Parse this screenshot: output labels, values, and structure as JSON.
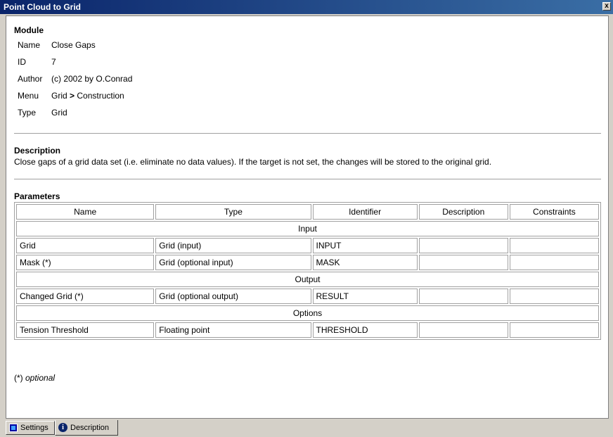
{
  "window": {
    "title": "Point Cloud to Grid",
    "close_glyph": "x"
  },
  "module": {
    "heading": "Module",
    "rows": [
      {
        "key": "Name",
        "value": "Close Gaps"
      },
      {
        "key": "ID",
        "value": "7"
      },
      {
        "key": "Author",
        "value": "(c) 2002 by O.Conrad"
      },
      {
        "key": "Menu",
        "value_parts": [
          "Grid ",
          ">",
          " Construction"
        ]
      },
      {
        "key": "Type",
        "value": "Grid"
      }
    ]
  },
  "description": {
    "heading": "Description",
    "text": "Close gaps of a grid data set (i.e. eliminate no data values). If the target is not set, the changes will be stored to the original grid."
  },
  "parameters": {
    "heading": "Parameters",
    "columns": [
      "Name",
      "Type",
      "Identifier",
      "Description",
      "Constraints"
    ],
    "groups": [
      {
        "label": "Input",
        "rows": [
          [
            "Grid",
            "Grid (input)",
            "INPUT",
            "",
            ""
          ],
          [
            "Mask (*)",
            "Grid (optional input)",
            "MASK",
            "",
            ""
          ]
        ]
      },
      {
        "label": "Output",
        "rows": [
          [
            "Changed Grid (*)",
            "Grid (optional output)",
            "RESULT",
            "",
            ""
          ]
        ]
      },
      {
        "label": "Options",
        "rows": [
          [
            "Tension Threshold",
            "Floating point",
            "THRESHOLD",
            "",
            ""
          ]
        ]
      }
    ],
    "note_prefix": "(*) ",
    "note_text": "optional"
  },
  "tabs": [
    {
      "label": "Settings",
      "icon": "settings-icon",
      "active": false
    },
    {
      "label": "Description",
      "icon": "info-icon",
      "active": true
    }
  ]
}
